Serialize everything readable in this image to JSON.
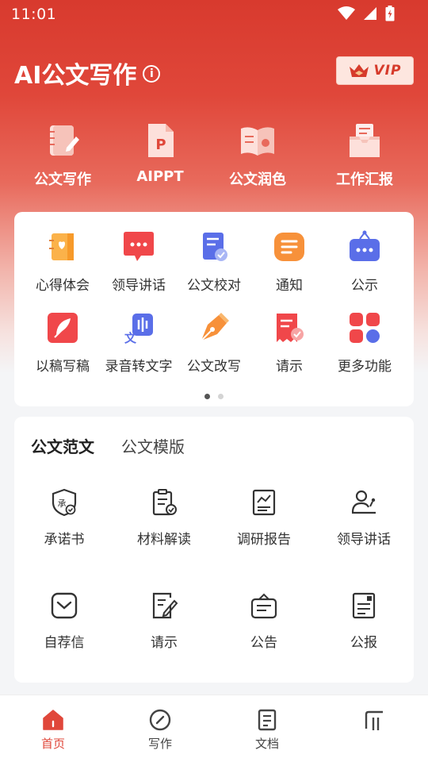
{
  "status_bar": {
    "time": "11:01"
  },
  "header": {
    "title": "AI公文写作",
    "vip_label": "VIP"
  },
  "top_features": [
    {
      "label": "公文写作",
      "icon": "notebook-pen-icon"
    },
    {
      "label": "AIPPT",
      "icon": "ppt-file-icon"
    },
    {
      "label": "公文润色",
      "icon": "open-book-icon"
    },
    {
      "label": "工作汇报",
      "icon": "inbox-report-icon"
    }
  ],
  "grid": {
    "items": [
      {
        "label": "心得体会",
        "icon": "heart-notebook-icon"
      },
      {
        "label": "领导讲话",
        "icon": "speech-bubble-icon"
      },
      {
        "label": "公文校对",
        "icon": "doc-check-icon"
      },
      {
        "label": "通知",
        "icon": "notice-icon"
      },
      {
        "label": "公示",
        "icon": "board-icon"
      },
      {
        "label": "以稿写稿",
        "icon": "feather-icon"
      },
      {
        "label": "录音转文字",
        "icon": "voice-text-icon"
      },
      {
        "label": "公文改写",
        "icon": "pen-nib-icon"
      },
      {
        "label": "请示",
        "icon": "receipt-check-icon"
      },
      {
        "label": "更多功能",
        "icon": "more-grid-icon"
      }
    ],
    "page_count": 2,
    "active_page": 1
  },
  "docs": {
    "tabs": [
      {
        "label": "公文范文",
        "active": true
      },
      {
        "label": "公文模版",
        "active": false
      }
    ],
    "items": [
      {
        "label": "承诺书",
        "icon": "shield-seal-icon"
      },
      {
        "label": "材料解读",
        "icon": "clipboard-check-icon"
      },
      {
        "label": "调研报告",
        "icon": "chart-report-icon"
      },
      {
        "label": "领导讲话",
        "icon": "speaker-podium-icon"
      },
      {
        "label": "自荐信",
        "icon": "envelope-icon"
      },
      {
        "label": "请示",
        "icon": "doc-edit-icon"
      },
      {
        "label": "公告",
        "icon": "announcement-icon"
      },
      {
        "label": "公报",
        "icon": "bulletin-icon"
      }
    ]
  },
  "nav": [
    {
      "label": "首页",
      "icon": "home-icon",
      "active": true
    },
    {
      "label": "写作",
      "icon": "compass-icon",
      "active": false
    },
    {
      "label": "文档",
      "icon": "document-icon",
      "active": false
    },
    {
      "label": "",
      "icon": "profile-icon",
      "active": false
    }
  ],
  "colors": {
    "accent": "#e0473a",
    "hero_top": "#d83a2e"
  }
}
